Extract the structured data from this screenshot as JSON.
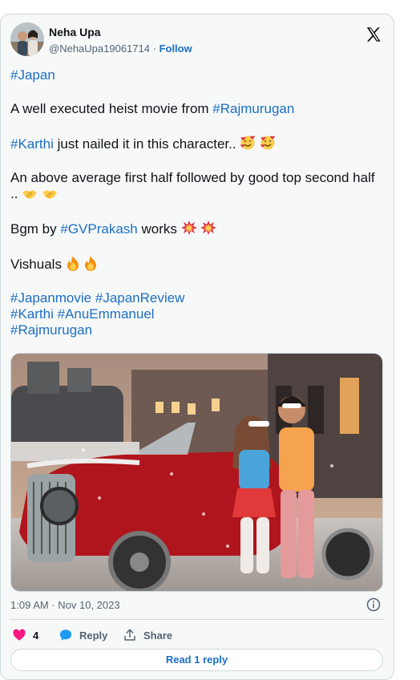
{
  "tweet": {
    "author": {
      "name": "Neha Upa",
      "handle": "@NehaUpa19061714",
      "separator": "·",
      "follow_label": "Follow"
    },
    "brand_icon": "x-logo-icon",
    "lines": {
      "l1_tag": "#Japan",
      "l2_text": "A well executed heist movie from ",
      "l2_tag": "#Rajmurugan",
      "l3_tag": "#Karthi",
      "l3_text": " just nailed it in this character..",
      "l4_text": "An above average first half followed by good top second half ..",
      "l5_text": "Bgm by ",
      "l5_tag": "#GVPrakash",
      "l5_text2": " works ",
      "l6_text": "Vishuals ",
      "tags_row1": [
        "#Japanmovie",
        "#JapanReview"
      ],
      "tags_row2": [
        "#Karthi",
        "#AnuEmmanuel"
      ],
      "tags_row3": [
        "#Rajmurugan"
      ]
    },
    "emojis": {
      "smiling_hearts": "smiling-face-with-hearts-icon",
      "handshake": "handshake-icon",
      "collision": "collision-icon",
      "fire": "fire-icon"
    },
    "timestamp": "1:09 AM · Nov 10, 2023",
    "actions": {
      "like_count": "4",
      "reply_label": "Reply",
      "share_label": "Share"
    },
    "read_reply_label": "Read 1 reply"
  },
  "colors": {
    "link": "#1d6ec4",
    "text": "#0f1419",
    "muted": "#536471",
    "like": "#f91880",
    "card_bg": "#f7f9f9",
    "border": "#cfd9de"
  }
}
